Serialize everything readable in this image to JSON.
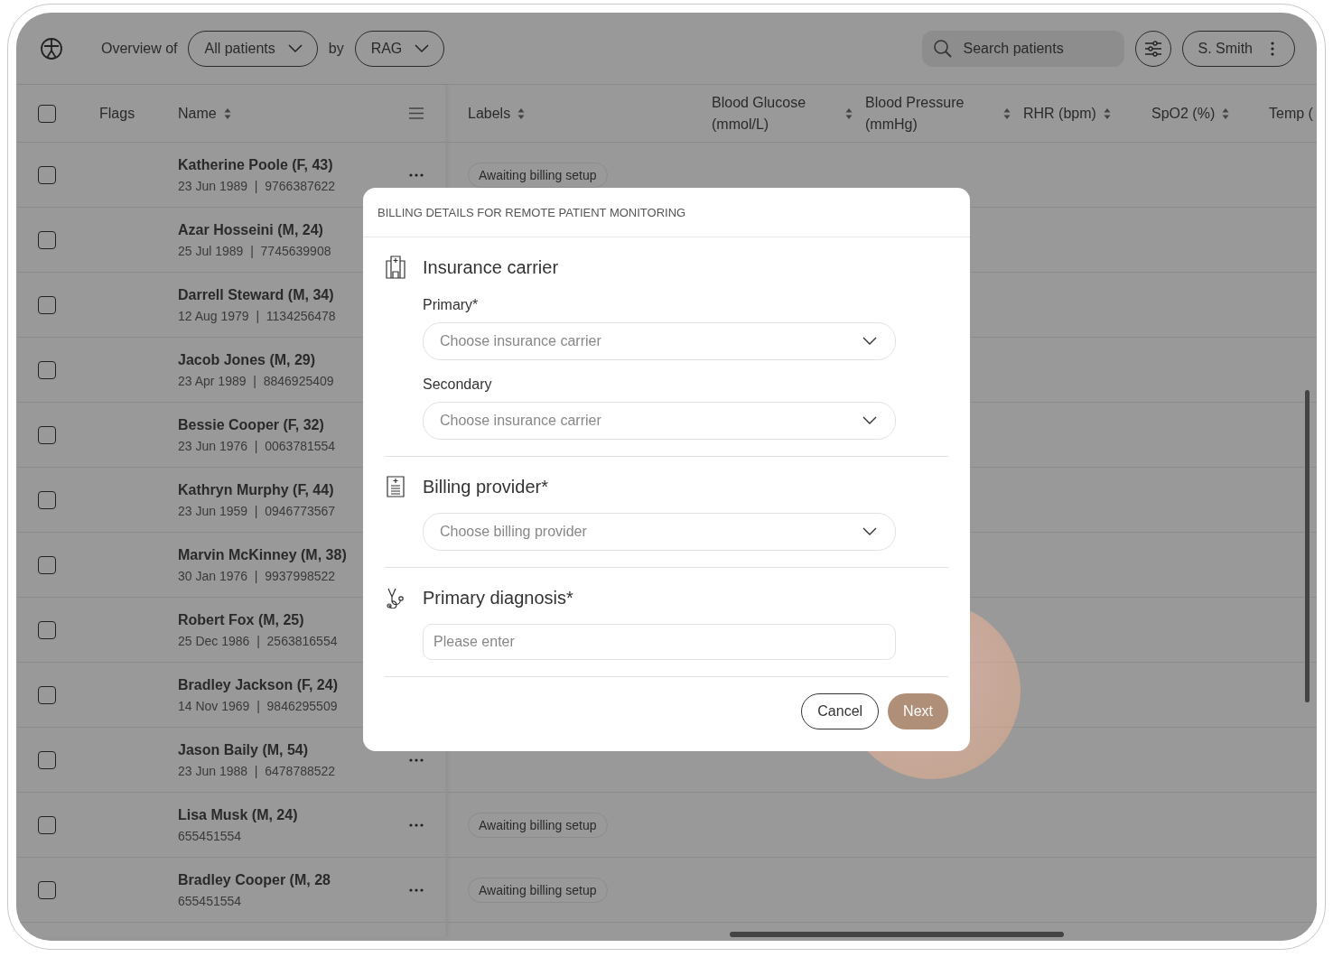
{
  "top_bar": {
    "overview_label": "Overview of",
    "population_select": {
      "value": "All patients"
    },
    "by_label": "by",
    "grouping_select": {
      "value": "RAG"
    },
    "search": {
      "placeholder": "Search patients"
    },
    "user_menu": {
      "label": "S. Smith"
    }
  },
  "table": {
    "select_all": {
      "checked": false
    },
    "frozen_columns": [
      {
        "label": "Flags",
        "sortable": false
      },
      {
        "label": "Name",
        "sortable": true
      }
    ],
    "columns": [
      {
        "label": "Labels",
        "sortable": true
      },
      {
        "label": "Blood Glucose (mmol/L)",
        "sortable": true
      },
      {
        "label": "Blood Pressure (mmHg)",
        "sortable": true
      },
      {
        "label": "RHR (bpm)",
        "sortable": true
      },
      {
        "label": "SpO2 (%)",
        "sortable": true
      },
      {
        "label": "Temp ("
      }
    ],
    "rows": [
      {
        "checked": false,
        "name": "Katherine Poole (F, 43)",
        "details": "23 Jun 1989  |  9766387622",
        "label": "Awaiting billing setup"
      },
      {
        "checked": false,
        "name": "Azar Hosseini (M, 24)",
        "details": "25 Jul 1989  |  7745639908"
      },
      {
        "checked": false,
        "name": "Darrell Steward (M, 34)",
        "details": "12 Aug 1979  |  1134256478"
      },
      {
        "checked": false,
        "name": "Jacob Jones (M, 29)",
        "details": "23 Apr 1989  |  8846925409"
      },
      {
        "checked": false,
        "name": "Bessie Cooper (F, 32)",
        "details": "23 Jun 1976  |  0063781554"
      },
      {
        "checked": false,
        "name": "Kathryn Murphy (F, 44)",
        "details": "23 Jun 1959  |  0946773567"
      },
      {
        "checked": false,
        "name": "Marvin McKinney (M, 38)",
        "details": "30 Jan 1976  |  9937998522"
      },
      {
        "checked": false,
        "name": "Robert Fox (M, 25)",
        "details": "25 Dec 1986  |  2563816554"
      },
      {
        "checked": false,
        "name": "Bradley Jackson (F, 24)",
        "details": "14 Nov 1969  |  9846295509"
      },
      {
        "checked": false,
        "name": "Jason Baily (M, 54)",
        "details": "23 Jun 1988  |  6478788522"
      },
      {
        "checked": false,
        "name": "Lisa Musk (M, 24)",
        "details": "655451554",
        "label": "Awaiting billing setup"
      },
      {
        "checked": false,
        "name": "Bradley Cooper (M, 28",
        "details": "655451554",
        "label": "Awaiting billing setup"
      }
    ]
  },
  "modal": {
    "title": "BILLING DETAILS FOR REMOTE PATIENT MONITORING",
    "sections": [
      {
        "kind": "insurance",
        "title": "Insurance carrier",
        "fields": [
          {
            "kind": "select",
            "label": "Primary*",
            "placeholder": "Choose insurance carrier"
          },
          {
            "kind": "select",
            "label": "Secondary",
            "placeholder": "Choose insurance carrier"
          }
        ]
      },
      {
        "kind": "provider",
        "title": "Billing provider*",
        "fields": [
          {
            "kind": "select",
            "placeholder": "Choose billing provider"
          }
        ]
      },
      {
        "kind": "diagnosis",
        "title": "Primary diagnosis*",
        "fields": [
          {
            "kind": "text",
            "placeholder": "Please enter"
          }
        ]
      }
    ],
    "buttons": [
      {
        "kind": "secondary",
        "label": "Cancel",
        "disabled": false
      },
      {
        "kind": "primary",
        "label": "Next",
        "disabled": true
      }
    ]
  }
}
